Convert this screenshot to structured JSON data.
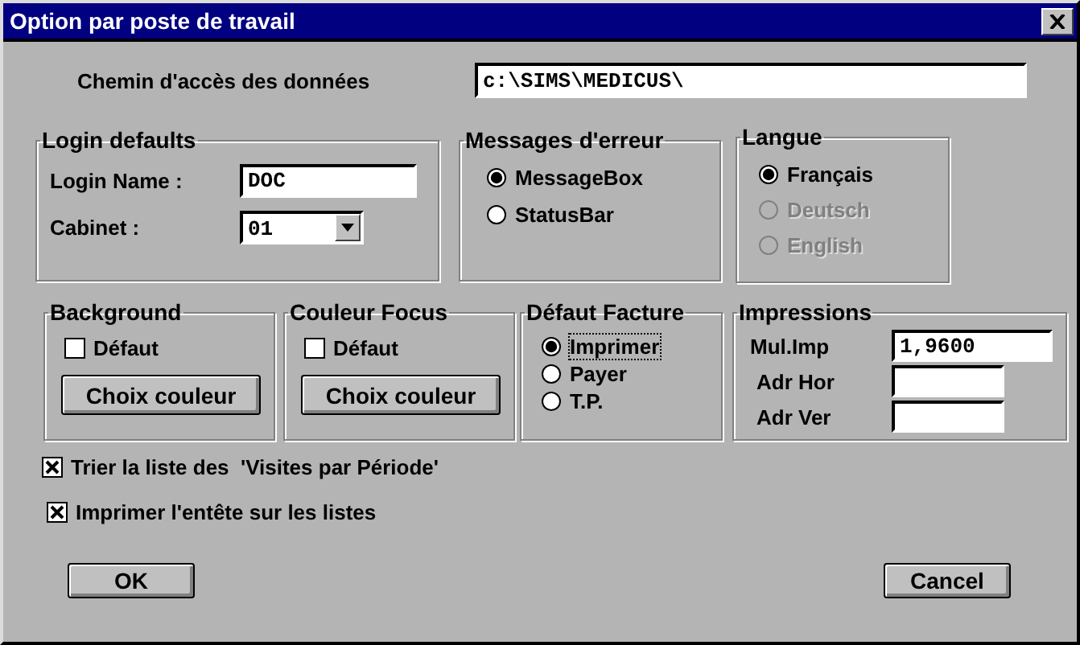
{
  "window": {
    "title": "Option par poste de travail"
  },
  "data_path": {
    "label": "Chemin d'accès des données",
    "value": "c:\\SIMS\\MEDICUS\\"
  },
  "login_defaults": {
    "title": "Login defaults",
    "login_name": {
      "label": "Login Name :",
      "value": "DOC"
    },
    "cabinet": {
      "label": "Cabinet :",
      "value": "01"
    }
  },
  "messages": {
    "title": "Messages d'erreur",
    "options": [
      {
        "label": "MessageBox",
        "selected": true
      },
      {
        "label": "StatusBar",
        "selected": false
      }
    ]
  },
  "langue": {
    "title": "Langue",
    "options": [
      {
        "label": "Français",
        "selected": true,
        "disabled": false
      },
      {
        "label": "Deutsch",
        "selected": false,
        "disabled": true
      },
      {
        "label": "English",
        "selected": false,
        "disabled": true
      }
    ]
  },
  "background": {
    "title": "Background",
    "default": {
      "label": "Défaut",
      "checked": false
    },
    "button": "Choix couleur"
  },
  "couleur_focus": {
    "title": "Couleur Focus",
    "default": {
      "label": "Défaut",
      "checked": false
    },
    "button": "Choix couleur"
  },
  "defaut_facture": {
    "title": "Défaut Facture",
    "options": [
      {
        "label": "Imprimer",
        "selected": true,
        "focused": true
      },
      {
        "label": "Payer",
        "selected": false,
        "focused": false
      },
      {
        "label": "T.P.",
        "selected": false,
        "focused": false
      }
    ]
  },
  "impressions": {
    "title": "Impressions",
    "fields": [
      {
        "label": "Mul.Imp",
        "value": "1,9600"
      },
      {
        "label": "Adr Hor"
      },
      {
        "label": "Adr Ver"
      }
    ]
  },
  "options": [
    {
      "label": "Trier la liste des  'Visites par Période'",
      "checked": true
    },
    {
      "label": "Imprimer l'entête sur les listes",
      "checked": true
    }
  ],
  "buttons": [
    {
      "label": "OK"
    },
    {
      "label": "Cancel"
    }
  ]
}
